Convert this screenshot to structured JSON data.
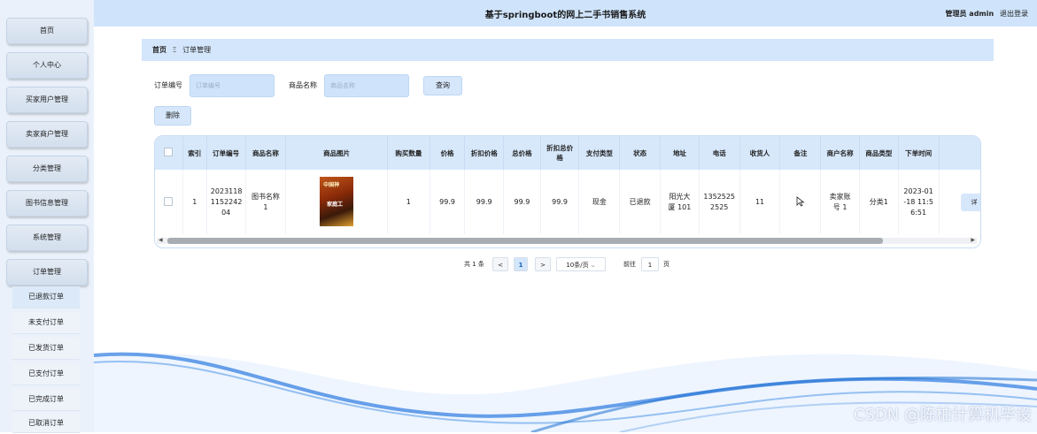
{
  "header": {
    "title": "基于springboot的网上二手书销售系统",
    "user_label": "管理员 admin",
    "logout": "退出登录"
  },
  "sidebar": {
    "items": [
      {
        "label": "首页"
      },
      {
        "label": "个人中心"
      },
      {
        "label": "买家用户管理"
      },
      {
        "label": "卖家商户管理"
      },
      {
        "label": "分类管理"
      },
      {
        "label": "图书信息管理"
      },
      {
        "label": "系统管理"
      },
      {
        "label": "订单管理"
      }
    ],
    "subitems": [
      {
        "label": "已退款订单"
      },
      {
        "label": "未支付订单"
      },
      {
        "label": "已发货订单"
      },
      {
        "label": "已支付订单"
      },
      {
        "label": "已完成订单"
      },
      {
        "label": "已取消订单"
      }
    ]
  },
  "breadcrumb": {
    "home": "首页",
    "separator": "Ξ",
    "current": "订单管理"
  },
  "search": {
    "order_no_label": "订单编号",
    "order_no_placeholder": "订单编号",
    "product_label": "商品名称",
    "product_placeholder": "商品名称",
    "query_button": "查询",
    "delete_button": "删除"
  },
  "table": {
    "columns": [
      "",
      "索引",
      "订单编号",
      "商品名称",
      "商品图片",
      "购买数量",
      "价格",
      "折扣价格",
      "总价格",
      "折扣总价格",
      "支付类型",
      "状态",
      "地址",
      "电话",
      "收货人",
      "备注",
      "商户名称",
      "商品类型",
      "下单时间",
      ""
    ],
    "rows": [
      {
        "index": "1",
        "order_no": "2023118 1152242 04",
        "product_name": "图书名称 1",
        "cover_text_1": "中国神",
        "cover_text_2": "家庭工",
        "quantity": "1",
        "price": "99.9",
        "discount_price": "99.9",
        "total_price": "99.9",
        "discount_total": "99.9",
        "pay_type": "现金",
        "status": "已退款",
        "address": "阳光大厦 101",
        "phone": "1352525 2525",
        "receiver": "11",
        "remark": "",
        "merchant": "卖家账号 1",
        "category": "分类1",
        "order_time": "2023-01 -18 11:5 6:51",
        "op": "详"
      }
    ]
  },
  "pagination": {
    "total": "共 1 条",
    "prev": "<",
    "current_page": "1",
    "next": ">",
    "page_size": "10条/页",
    "goto_label": "前往",
    "goto_value": "1",
    "page_unit": "页"
  },
  "watermark": "CSDN @陈柏计算机毕设",
  "colors": {
    "accent": "#d4e6fb",
    "sidebar": "#eaf1fa",
    "wave": "#1e6fd0"
  }
}
